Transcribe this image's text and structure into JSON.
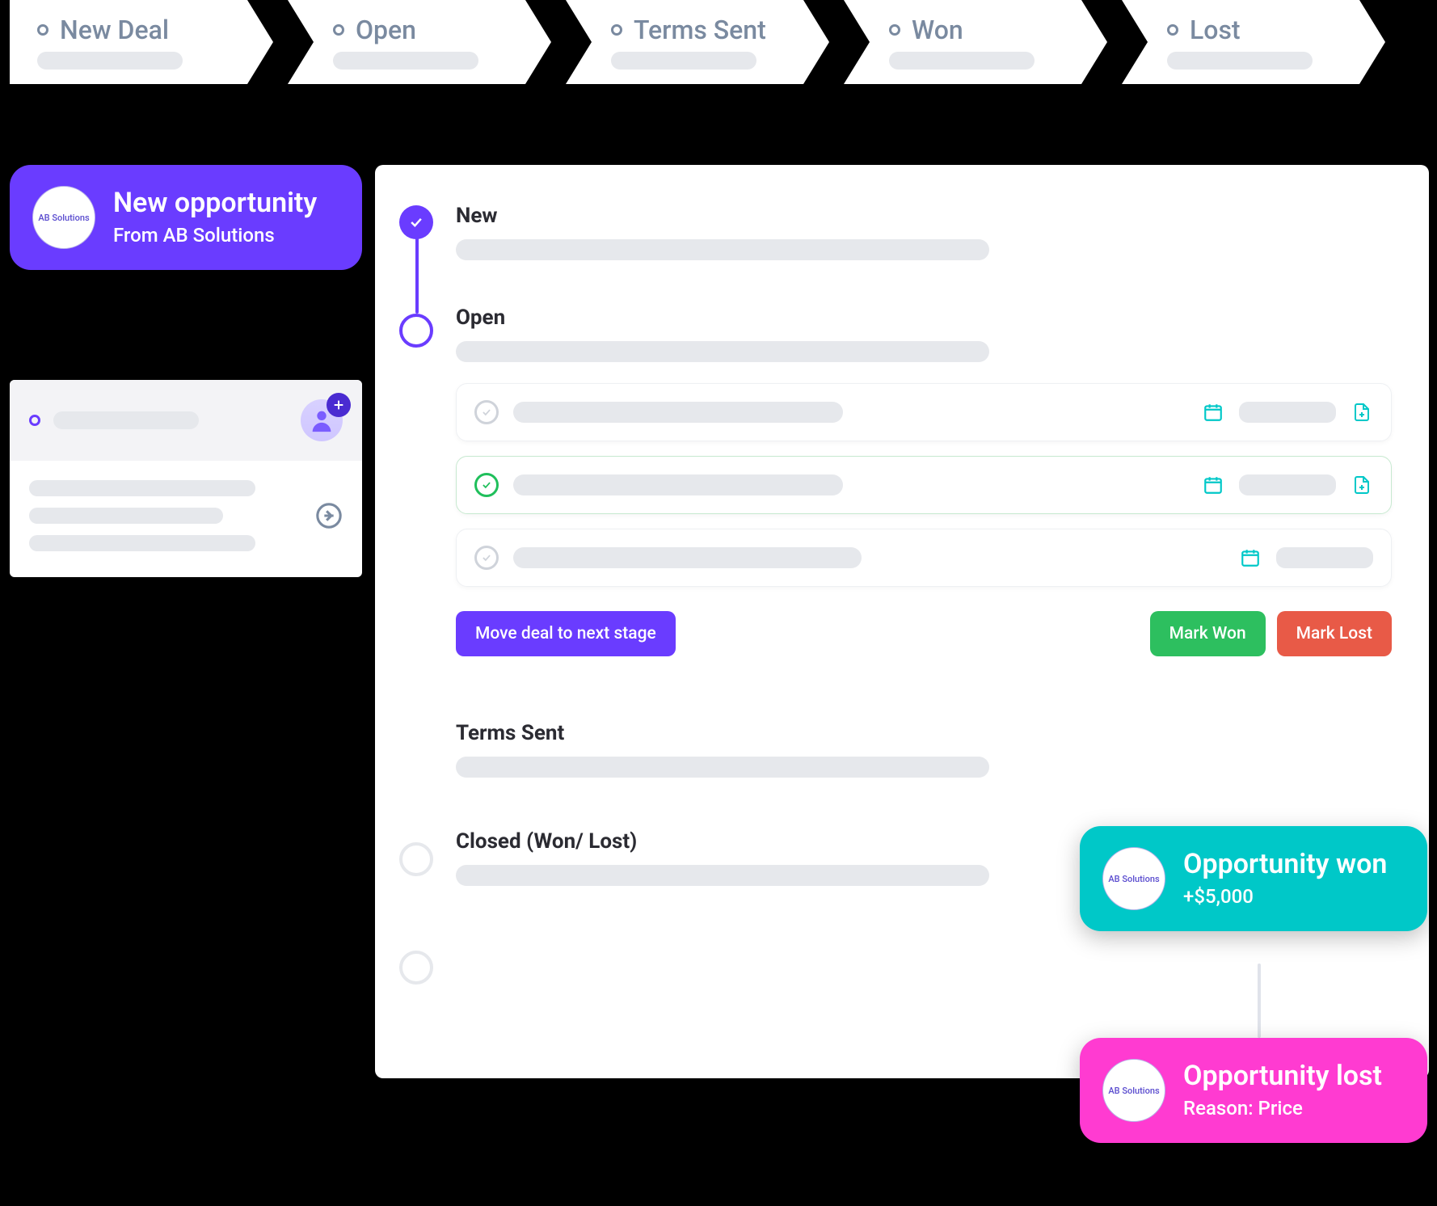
{
  "pipeline": [
    {
      "label": "New Deal",
      "ring": "green-ring"
    },
    {
      "label": "Open",
      "ring": "pink-ring"
    },
    {
      "label": "Terms Sent",
      "ring": "purple-ring"
    },
    {
      "label": "Won",
      "ring": "green-ring"
    },
    {
      "label": "Lost",
      "ring": "red-ring"
    }
  ],
  "notif_new": {
    "company": "AB Solutions",
    "title": "New opportunity",
    "subtitle": "From AB Solutions"
  },
  "notif_won": {
    "company": "AB Solutions",
    "title": "Opportunity won",
    "subtitle": "+$5,000"
  },
  "notif_lost": {
    "company": "AB Solutions",
    "title": "Opportunity lost",
    "subtitle": "Reason: Price"
  },
  "timeline": {
    "steps": {
      "new": "New",
      "open": "Open",
      "terms": "Terms Sent",
      "closed": "Closed (Won/ Lost)"
    },
    "actions": {
      "move_next": "Move deal to next stage",
      "mark_won": "Mark Won",
      "mark_lost": "Mark Lost"
    }
  }
}
